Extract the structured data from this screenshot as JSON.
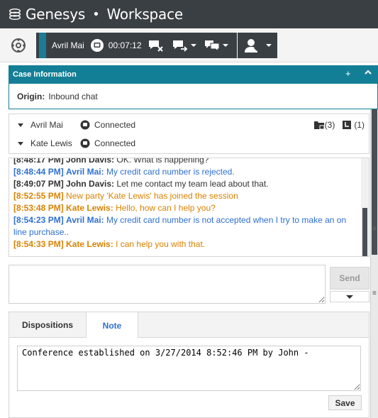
{
  "app": {
    "brand": "Genesys",
    "separator": "•",
    "product": "Workspace"
  },
  "toolbar": {
    "contact_name": "Avril Mai",
    "timer": "00:07:12",
    "icons": [
      "gear-icon",
      "chat-bubble-icon",
      "end-chat-icon",
      "transfer-chat-icon",
      "conference-chat-icon",
      "agent-status-icon"
    ]
  },
  "case": {
    "header": "Case Information",
    "add_symbol": "+",
    "collapse_symbol": "^",
    "origin_label": "Origin:",
    "origin_value": "Inbound chat"
  },
  "parties": [
    {
      "name": "Avril Mai",
      "status": "Connected"
    },
    {
      "name": "Kate Lewis",
      "status": "Connected"
    }
  ],
  "counts": {
    "cases": "(3)",
    "history": "(1)"
  },
  "transcript": [
    {
      "time": "[8:48:17 PM]",
      "who": "John Davis:",
      "text": "OK. What is happening?",
      "color": "dark"
    },
    {
      "time": "[8:48:44 PM]",
      "who": "Avril Mai:",
      "text": "My credit card number is rejected.",
      "color": "blue"
    },
    {
      "time": "[8:49:07 PM]",
      "who": "John Davis:",
      "text": "Let me contact my team lead about that.",
      "color": "dark"
    },
    {
      "time": "[8:52:55 PM]",
      "who": "",
      "text": "New party 'Kate Lewis' has joined the session",
      "color": "orange"
    },
    {
      "time": "[8:53:48 PM]",
      "who": "Kate Lewis:",
      "text": "Hello, how can I help you?",
      "color": "orange"
    },
    {
      "time": "[8:54:23 PM]",
      "who": "Avril Mai:",
      "text": "My credit card number is not accepted when I try to make an on line purchase..",
      "color": "blue"
    },
    {
      "time": "[8:54:33 PM]",
      "who": "Kate Lewis:",
      "text": "I can help you with that.",
      "color": "orange"
    }
  ],
  "composer": {
    "value": "",
    "send_label": "Send"
  },
  "tabs": [
    {
      "label": "Dispositions",
      "active": false
    },
    {
      "label": "Note",
      "active": true
    }
  ],
  "note": {
    "text": "Conference established on 3/27/2014 8:52:46 PM by John -",
    "save_label": "Save"
  },
  "colors": {
    "titlebar": "#3a3f44",
    "accent": "#137f96",
    "blue_text": "#2f6fd0",
    "orange_text": "#d98200"
  }
}
